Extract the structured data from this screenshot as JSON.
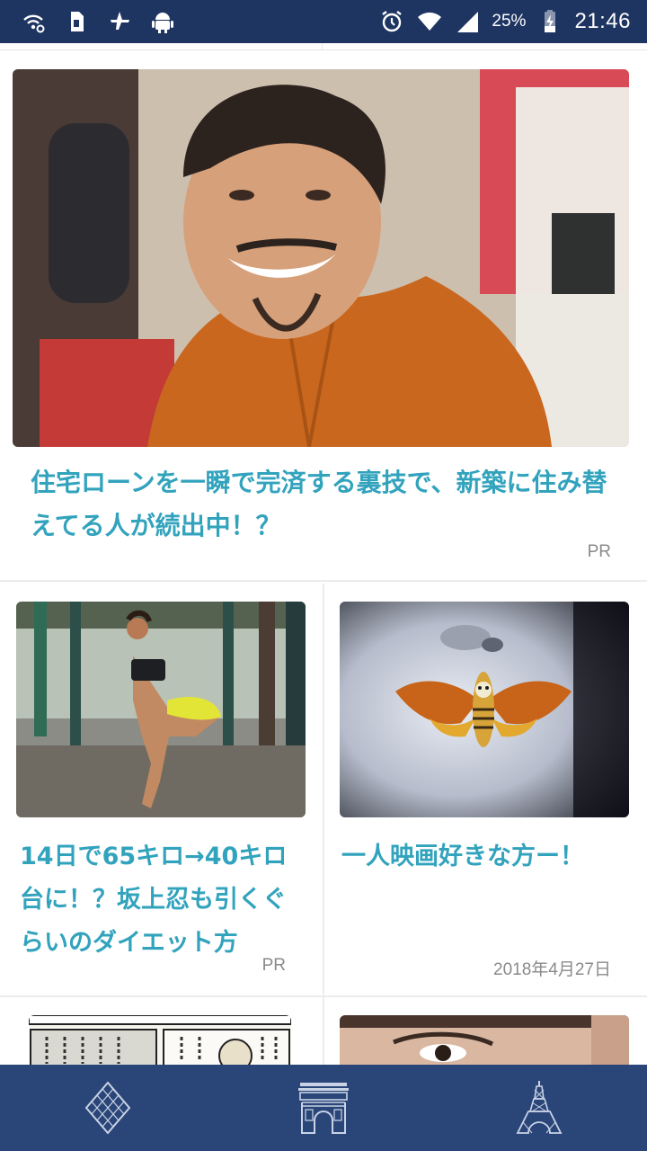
{
  "status_bar": {
    "left_icons": [
      "wifi-call-icon",
      "sim-card-icon",
      "airplane-icon",
      "android-icon"
    ],
    "right_icons": [
      "alarm-icon",
      "wifi-icon",
      "signal-icon",
      "battery-charging-icon"
    ],
    "battery_percent": "25%",
    "time": "21:46"
  },
  "feed": {
    "featured": {
      "image": "photo of smiling man in orange fleece",
      "title": "住宅ローンを一瞬で完済する裏技で、新築に住み替えてる人が続出中！？",
      "badge": "PR"
    },
    "row1": [
      {
        "image": "photo of woman doing squats",
        "title": "14日で65キロ→40キロ台に！？坂上忍も引くぐらいのダイエット方",
        "badge": "PR"
      },
      {
        "image": "moth on lips movie poster",
        "title": "一人映画好きな方ー！",
        "date": "2018年4月27日"
      }
    ],
    "row2": [
      {
        "image": "manga panels"
      },
      {
        "image": "close-up of woman eye"
      }
    ]
  },
  "bottom_nav": {
    "items": [
      "diamond-icon",
      "arc-de-triomphe-icon",
      "eiffel-tower-icon"
    ]
  },
  "colors": {
    "status_bar_bg": "#1e3461",
    "nav_bg": "#2a4577",
    "title": "#32a3bd",
    "meta": "#8a8a8a"
  }
}
